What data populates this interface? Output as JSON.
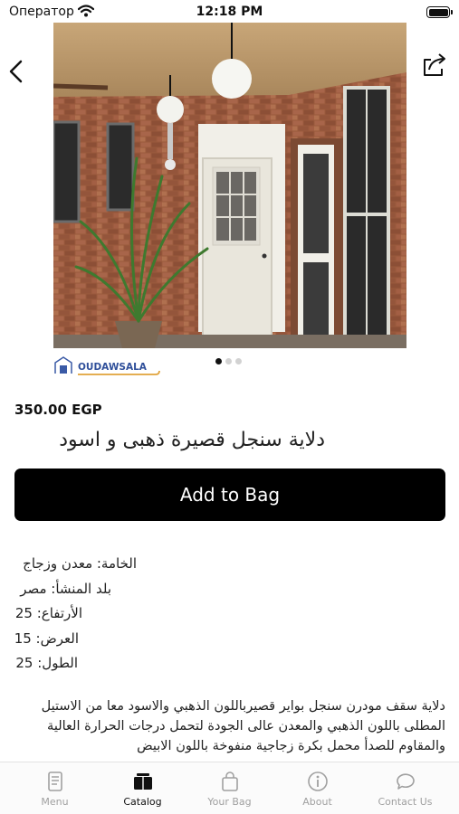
{
  "status_bar": {
    "carrier": "Оператор",
    "time": "12:18 PM",
    "battery_level": 1.0
  },
  "nav": {
    "back_icon": "chevron-left-icon",
    "share_icon": "share-icon"
  },
  "gallery": {
    "image_count": 3,
    "active_index": 0
  },
  "brand": {
    "logo_text": "OUDAWSALA"
  },
  "product": {
    "price": "350.00 EGP",
    "title": "دلاية سنجل قصيرة ذهبى و اسود",
    "add_to_bag_label": "Add to Bag",
    "specs": [
      "الخامة: معدن وزجاج",
      "بلد المنشأ: مصر",
      "الأرتفاع: 25",
      "العرض: 15",
      "الطول: 25"
    ],
    "description": "دلاية سقف مودرن سنجل بواير قصيرباللون الذهبي والاسود معا من الاستيل المطلى باللون الذهبي والمعدن عالى الجودة لتحمل درجات الحرارة العالية والمقاوم للصدأ محمل بكرة زجاجية منفوخة باللون الابيض"
  },
  "tabbar": {
    "active_tab": "Catalog",
    "tabs": [
      {
        "label": "Menu",
        "icon": "menu-book-icon"
      },
      {
        "label": "Catalog",
        "icon": "catalog-icon"
      },
      {
        "label": "Your Bag",
        "icon": "bag-icon"
      },
      {
        "label": "About",
        "icon": "info-icon"
      },
      {
        "label": "Contact Us",
        "icon": "chat-icon"
      }
    ]
  },
  "colors": {
    "button_bg": "#000000",
    "active_tab": "#111111",
    "inactive_tab": "#a0a0a0"
  }
}
